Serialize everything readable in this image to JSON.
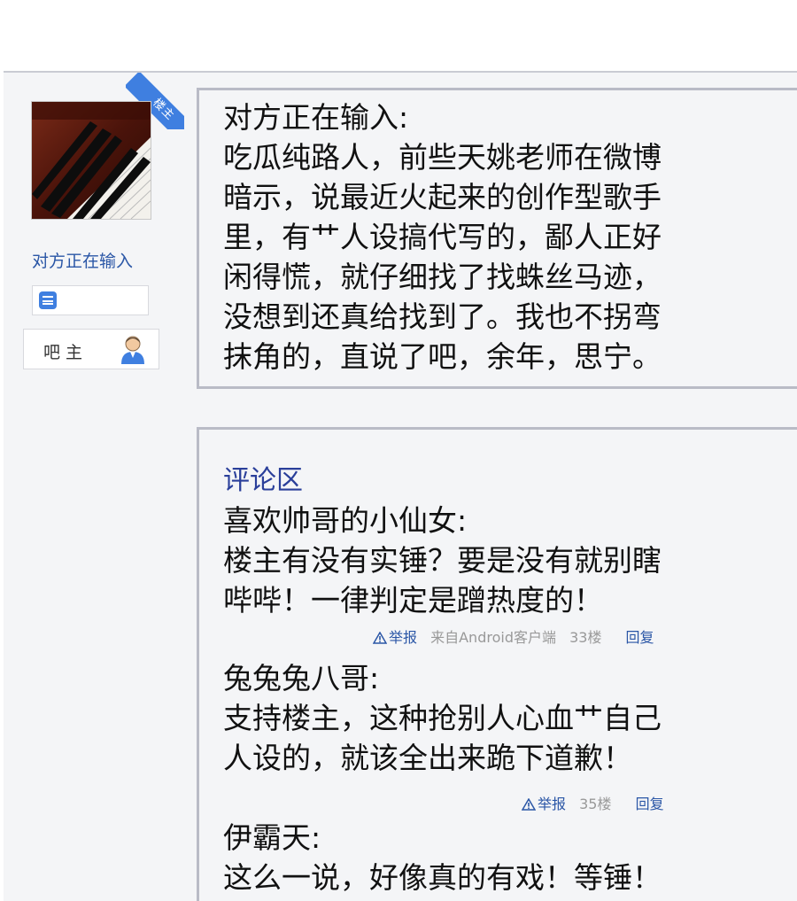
{
  "sidebar": {
    "ribbon_label": "楼主",
    "username": "对方正在输入",
    "owner_label": "吧主"
  },
  "post": {
    "lines": [
      "对方正在输入:",
      "吃瓜纯路人，前些天姚老师在微博",
      "暗示，说最近火起来的创作型歌手",
      "里，有艹人设搞代写的，鄙人正好",
      "闲得慌，就仔细找了找蛛丝马迹，",
      "没想到还真给找到了。我也不拐弯",
      "抹角的，直说了吧，余年，思宁。"
    ]
  },
  "comments": {
    "title": "评论区",
    "items": [
      {
        "lines": [
          "喜欢帅哥的小仙女:",
          "楼主有没有实锤？要是没有就别瞎",
          "哔哔！一律判定是蹭热度的！"
        ],
        "report": "举报",
        "source": "来自Android客户端",
        "floor": "33楼",
        "reply": "回复"
      },
      {
        "lines": [
          "兔兔兔八哥:",
          "支持楼主，这种抢别人心血艹自己",
          "人设的，就该全出来跪下道歉！"
        ],
        "report": "举报",
        "floor": "35楼",
        "reply": "回复"
      },
      {
        "lines": [
          "伊霸天:",
          "这么一说，好像真的有戏！等锤！"
        ]
      }
    ]
  },
  "colors": {
    "accent": "#3f7fe0",
    "link": "#2a56a6",
    "title": "#2a3f9a",
    "border": "#b9bbc6",
    "panel": "#f4f5f7"
  }
}
